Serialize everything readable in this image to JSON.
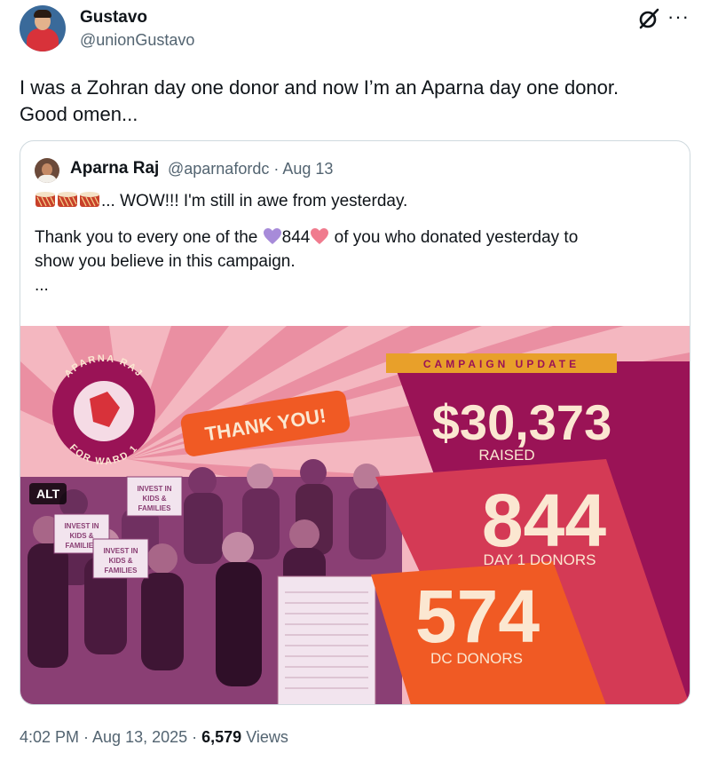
{
  "author": {
    "name": "Gustavo",
    "handle": "@unionGustavo"
  },
  "tweet": {
    "line1": "I was a Zohran day one donor and now I’m an Aparna day one donor.",
    "line2": "Good omen..."
  },
  "menu": {
    "more_label": "···",
    "grok_icon": "grok-icon"
  },
  "quote": {
    "name": "Aparna Raj",
    "meta": "@aparnafordc · Aug 13",
    "line1": "... WOW!!! I'm still in awe from yesterday.",
    "line2_pre": "Thank you to every one of the ",
    "line2_num": "844",
    "line2_post": " of you who donated yesterday to",
    "line3": "show you believe in this campaign.",
    "line4": "..."
  },
  "image": {
    "badge_top": "APARNA RAJ",
    "badge_bottom": "FOR WARD 1",
    "thank_you": "THANK YOU!",
    "update_label": "CAMPAIGN UPDATE",
    "raised_amount": "$30,373",
    "raised_label": "RAISED",
    "day1_count": "844",
    "day1_label": "DAY 1 DONORS",
    "dc_count": "574",
    "dc_label": "DC DONORS",
    "sign1": "INVEST IN KIDS & FAMILIES",
    "sign2": "INVEST IN KIDS & FAMILIES",
    "sign3": "INVEST IN KIDS & FAMILIES",
    "alt": "ALT"
  },
  "footer": {
    "time": "4:02 PM · Aug 13, 2025 · ",
    "views_count": "6,579",
    "views_label": " Views"
  },
  "colors": {
    "accent_orange": "#f05a24",
    "magenta": "#9a1356",
    "cream": "#fbe7d1",
    "gold": "#e8a02a"
  }
}
